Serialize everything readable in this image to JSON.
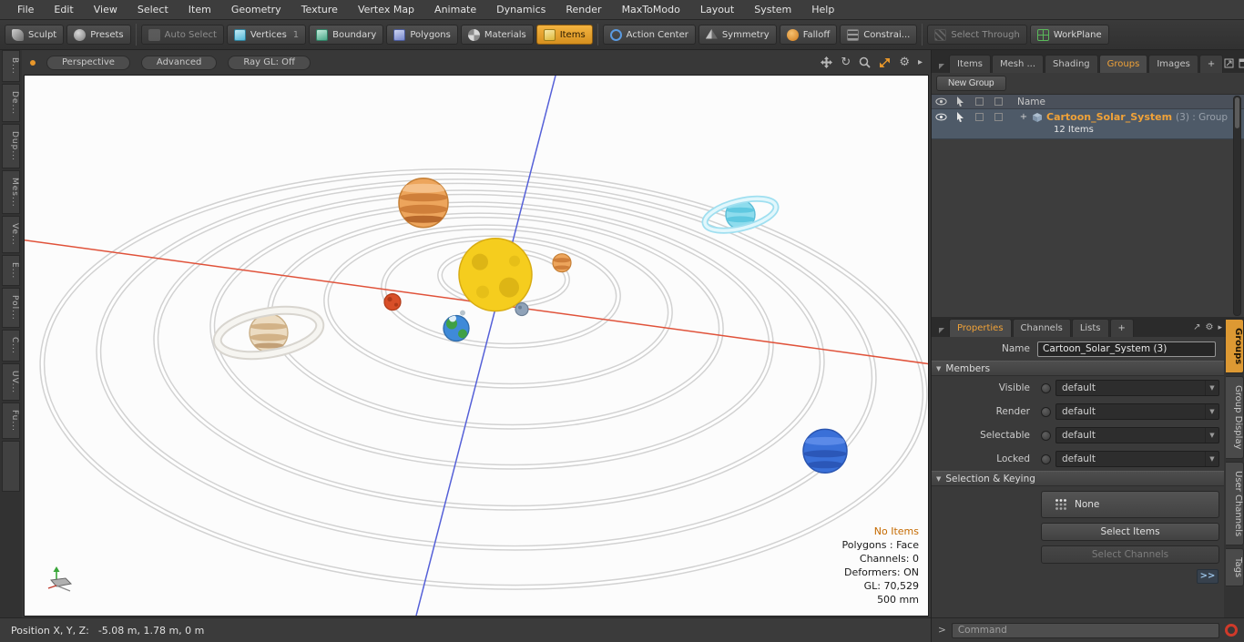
{
  "menubar": {
    "items": [
      "File",
      "Edit",
      "View",
      "Select",
      "Item",
      "Geometry",
      "Texture",
      "Vertex Map",
      "Animate",
      "Dynamics",
      "Render",
      "MaxToModo",
      "Layout",
      "System",
      "Help"
    ]
  },
  "toolbar": {
    "labels": [
      "Sculpt",
      "Presets",
      "Auto Select",
      "Vertices",
      "Boundary",
      "Polygons",
      "Materials",
      "Items",
      "Action Center",
      "Symmetry",
      "Falloff",
      "Constrai...",
      "Select Through",
      "WorkPlane"
    ],
    "vertices_count": "1"
  },
  "left_strip": {
    "tabs": [
      "B...",
      "De...",
      "Dup...",
      "Mes...",
      "Ve...",
      "E...",
      "Pol...",
      "C...",
      "UV...",
      "Fu..."
    ]
  },
  "viewport": {
    "mode": "Perspective",
    "shading": "Advanced",
    "raygl": "Ray GL: Off",
    "stats": {
      "selection": "No Items",
      "polygons": "Polygons : Face",
      "channels": "Channels: 0",
      "deformers": "Deformers: ON",
      "gl": "GL: 70,529",
      "scale": "500 mm"
    }
  },
  "statusbar": {
    "label": "Position X, Y, Z:",
    "value": "-5.08 m,  1.78 m,  0 m"
  },
  "right_panel": {
    "tabs": [
      "Items",
      "Mesh ...",
      "Shading",
      "Groups",
      "Images",
      "+"
    ],
    "new_group": "New Group",
    "list": {
      "name_header": "Name",
      "group_name": "Cartoon_Solar_System",
      "group_suffix": "(3) : Group",
      "group_items": "12 Items"
    },
    "props_tabs": [
      "Properties",
      "Channels",
      "Lists",
      "+"
    ],
    "name_label": "Name",
    "name_value": "Cartoon_Solar_System (3)",
    "members_header": "Members",
    "member_rows": [
      {
        "label": "Visible",
        "value": "default"
      },
      {
        "label": "Render",
        "value": "default"
      },
      {
        "label": "Selectable",
        "value": "default"
      },
      {
        "label": "Locked",
        "value": "default"
      }
    ],
    "selection_header": "Selection & Keying",
    "none_label": "None",
    "select_items_label": "Select Items",
    "select_channels_label": "Select Channels",
    "expand_label": ">>",
    "edge_tabs": [
      "Groups",
      "Group Display",
      "User Channels",
      "Tags"
    ],
    "command_prompt": ">",
    "command_placeholder": "Command"
  },
  "icons": {
    "rotate": "↻",
    "gear": "⚙",
    "arrow": "▸",
    "dropdown": "▼",
    "collapse": "▼",
    "tree_expand": "+",
    "expand_diag": "↗"
  },
  "colors": {
    "accent_orange": "#f0a238",
    "selection_row": "#4e5a68",
    "viewport_bg": "#fcfcfc",
    "axis_x": "#e0523a",
    "axis_z": "#5560d8"
  }
}
